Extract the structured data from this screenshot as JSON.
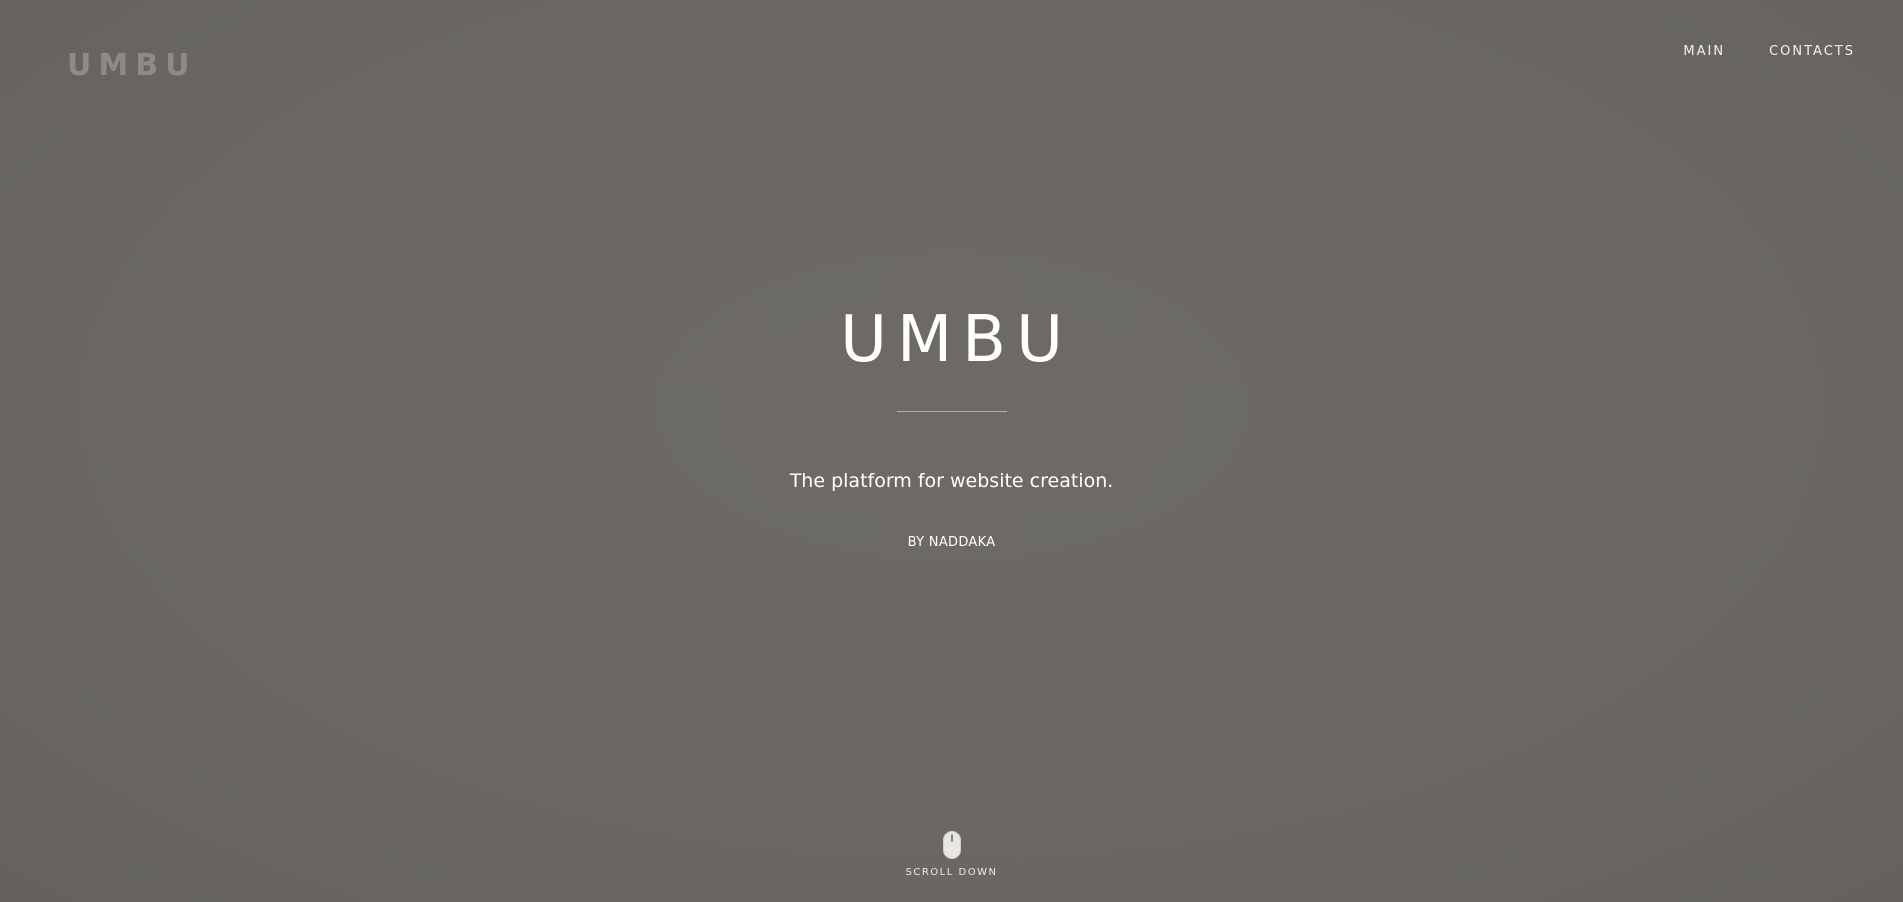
{
  "header": {
    "logo": "UMBU",
    "nav": [
      {
        "label": "MAIN"
      },
      {
        "label": "CONTACTS"
      }
    ]
  },
  "hero": {
    "title": "UMBU",
    "tagline": "The platform for website creation.",
    "byline": "BY NADDAKA"
  },
  "scroll": {
    "label": "SCROLL DOWN",
    "icon": "mouse-icon"
  },
  "colors": {
    "background": "#6b6863",
    "logo": "#8e8a86",
    "text": "#ffffff"
  }
}
